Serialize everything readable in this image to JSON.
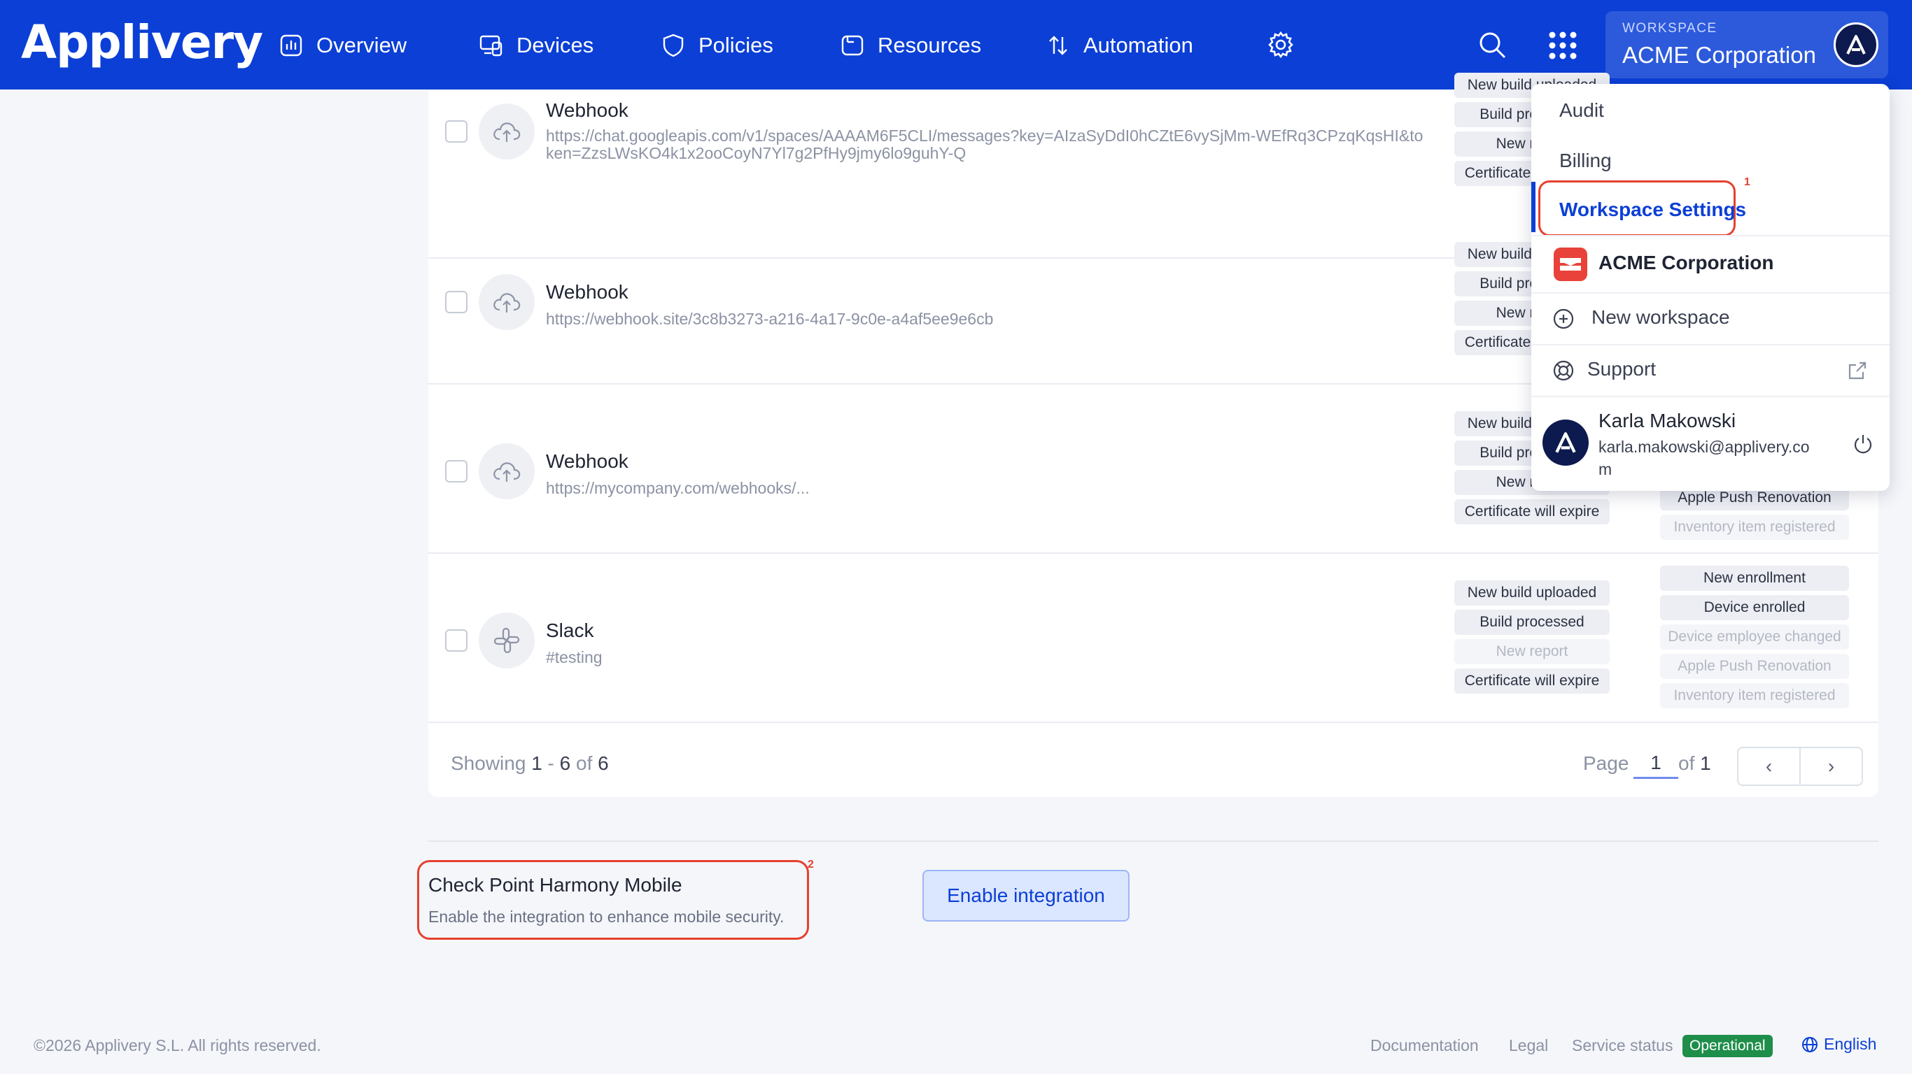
{
  "brand": {
    "logo_text": "Applivery",
    "primary_color": "#0b3fd6"
  },
  "nav": {
    "overview": "Overview",
    "devices": "Devices",
    "policies": "Policies",
    "resources": "Resources",
    "automation": "Automation"
  },
  "workspace": {
    "label": "WORKSPACE",
    "name": "ACME Corporation"
  },
  "rows": [
    {
      "title": "Webhook",
      "subtitle": "https://chat.googleapis.com/v1/spaces/AAAAM6F5CLI/messages?key=AIzaSyDdI0hCZtE6vySjMm-WEfRq3CPzqKqsHI&token=ZzsLWsKO4k1x2ooCoyN7Yl7g2PfHy9jmy6lo9guhY-Q",
      "tags_col1": [
        "New build uploaded",
        "Build processed",
        "New report",
        "Certificate will expire"
      ]
    },
    {
      "title": "Webhook",
      "subtitle": "https://webhook.site/3c8b3273-a216-4a17-9c0e-a4af5ee9e6cb",
      "tags_col1": [
        "New build uploaded",
        "Build processed",
        "New report",
        "Certificate will expire"
      ]
    },
    {
      "title": "Webhook",
      "subtitle": "https://mycompany.com/webhooks/...",
      "tags_col1": [
        "New build uploaded",
        "Build processed",
        "New report",
        "Certificate will expire"
      ],
      "tags_col2": [
        "Apple Push Renovation",
        "Inventory item registered"
      ]
    },
    {
      "title": "Slack",
      "subtitle": "#testing",
      "tags_col1": [
        "New build uploaded",
        "Build processed",
        "New report",
        "Certificate will expire"
      ],
      "tags_col2": [
        "New enrollment",
        "Device enrolled",
        "Device employee changed",
        "Apple Push Renovation",
        "Inventory item registered"
      ]
    }
  ],
  "pagination": {
    "showing_label": "Showing",
    "range_start": "1",
    "range_sep": " - ",
    "range_end": "6",
    "of_label": " of ",
    "total": "6",
    "page_label": "Page",
    "page": "1",
    "page_of": "of",
    "page_total": "1",
    "prev_icon": "‹",
    "next_icon": "›"
  },
  "integration": {
    "title": "Check Point Harmony Mobile",
    "description": "Enable the integration to enhance mobile security.",
    "button": "Enable integration",
    "marker": "2"
  },
  "dropdown": {
    "audit": "Audit",
    "billing": "Billing",
    "workspace_settings": "Workspace Settings",
    "marker": "1",
    "workspace_name": "ACME Corporation",
    "new_workspace": "New workspace",
    "support": "Support",
    "user_name": "Karla Makowski",
    "user_email_line1": "karla.makowski@applivery.co",
    "user_email_line2": "m"
  },
  "footer": {
    "copyright": "©2026 Applivery S.L. All rights reserved.",
    "documentation": "Documentation",
    "legal": "Legal",
    "service_status": "Service status",
    "status_badge": "Operational",
    "status_color": "#1e8e4a",
    "language": "English"
  }
}
